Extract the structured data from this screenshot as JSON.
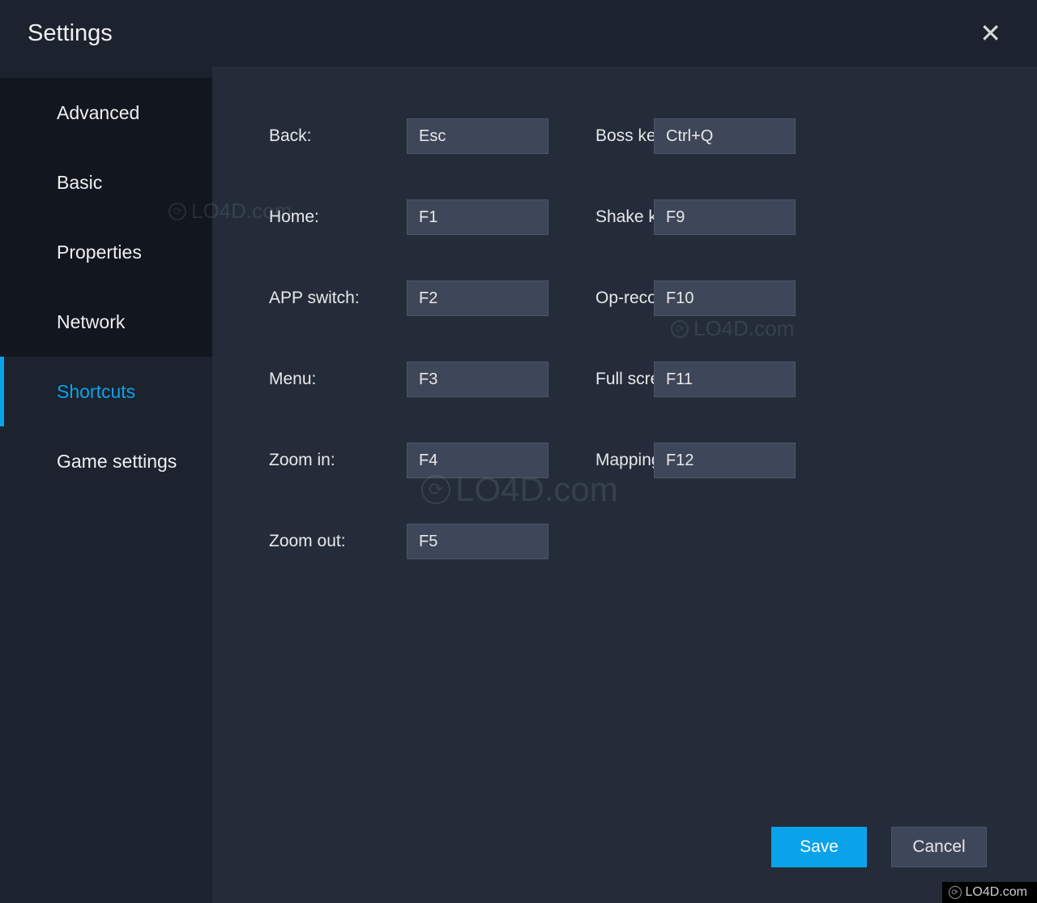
{
  "header": {
    "title": "Settings"
  },
  "sidebar": {
    "items": [
      {
        "label": "Advanced",
        "active": false,
        "dark": true
      },
      {
        "label": "Basic",
        "active": false,
        "dark": true
      },
      {
        "label": "Properties",
        "active": false,
        "dark": true
      },
      {
        "label": "Network",
        "active": false,
        "dark": true
      },
      {
        "label": "Shortcuts",
        "active": true,
        "dark": false
      },
      {
        "label": "Game settings",
        "active": false,
        "dark": false
      }
    ]
  },
  "shortcuts": {
    "rows": [
      {
        "leftLabel": "Back:",
        "leftValue": "Esc",
        "rightLabel": "Boss key:",
        "rightValue": "Ctrl+Q"
      },
      {
        "leftLabel": "Home:",
        "leftValue": "F1",
        "rightLabel": "Shake key:",
        "rightValue": "F9"
      },
      {
        "leftLabel": "APP switch:",
        "leftValue": "F2",
        "rightLabel": "Op-record:",
        "rightValue": "F10"
      },
      {
        "leftLabel": "Menu:",
        "leftValue": "F3",
        "rightLabel": "Full screen:",
        "rightValue": "F11"
      },
      {
        "leftLabel": "Zoom in:",
        "leftValue": "F4",
        "rightLabel": "Mappings:",
        "rightValue": "F12"
      },
      {
        "leftLabel": "Zoom out:",
        "leftValue": "F5",
        "rightLabel": "",
        "rightValue": ""
      }
    ]
  },
  "footer": {
    "save": "Save",
    "cancel": "Cancel"
  },
  "watermark": "LO4D.com"
}
